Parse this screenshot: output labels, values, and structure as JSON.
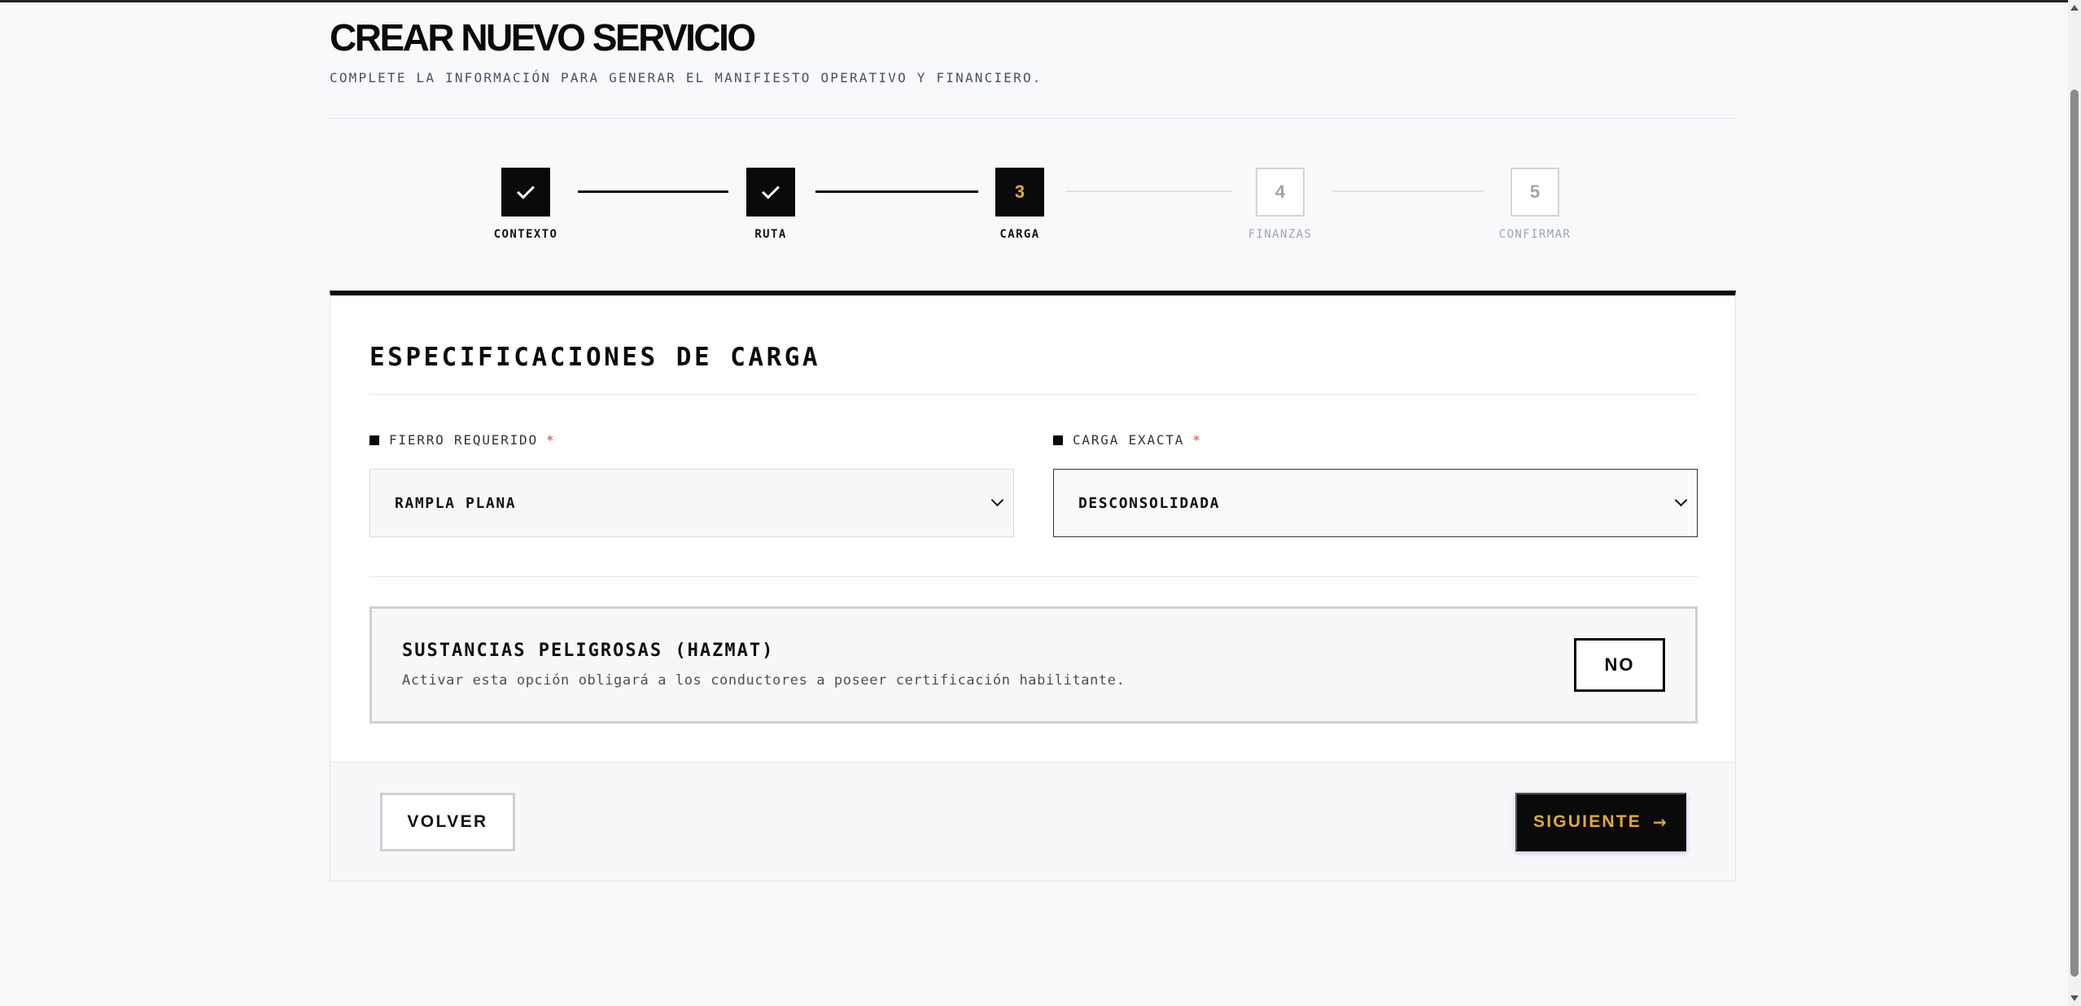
{
  "header": {
    "title": "CREAR NUEVO SERVICIO",
    "subtitle": "COMPLETE LA INFORMACIÓN PARA GENERAR EL MANIFIESTO OPERATIVO Y FINANCIERO."
  },
  "stepper": {
    "current": 3,
    "steps": [
      {
        "number": "1",
        "label": "CONTEXTO",
        "status": "done"
      },
      {
        "number": "2",
        "label": "RUTA",
        "status": "done"
      },
      {
        "number": "3",
        "label": "CARGA",
        "status": "active"
      },
      {
        "number": "4",
        "label": "FINANZAS",
        "status": "todo"
      },
      {
        "number": "5",
        "label": "CONFIRMAR",
        "status": "todo"
      }
    ]
  },
  "card": {
    "title": "ESPECIFICACIONES DE CARGA",
    "fields": {
      "fierro": {
        "label": "FIERRO REQUERIDO",
        "required_mark": "*",
        "value": "RAMPLA PLANA"
      },
      "carga": {
        "label": "CARGA EXACTA",
        "required_mark": "*",
        "value": "DESCONSOLIDADA"
      }
    },
    "hazmat": {
      "title": "SUSTANCIAS PELIGROSAS (HAZMAT)",
      "description": "Activar esta opción obligará a los conductores a poseer certificación habilitante.",
      "toggle_label": "NO"
    }
  },
  "footer": {
    "back_label": "VOLVER",
    "next_label": "SIGUIENTE",
    "next_arrow": "→"
  },
  "colors": {
    "accent": "#e0a93a",
    "primary": "#0a0a0a",
    "required": "#e03a3a"
  },
  "icons": {
    "done_step": "check-icon",
    "select": "chevron-down-icon",
    "next": "arrow-right-icon"
  }
}
